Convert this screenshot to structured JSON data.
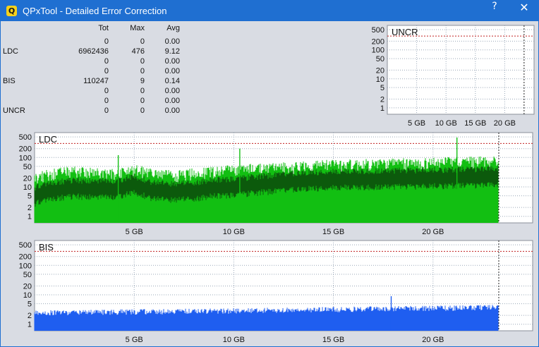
{
  "window": {
    "title": "QPxTool - Detailed Error Correction",
    "app_icon_glyph": "Q",
    "help_glyph": "?",
    "close_glyph": "✕",
    "titlebar_color": "#1f6fd1"
  },
  "stats": {
    "headers": {
      "tot": "Tot",
      "max": "Max",
      "avg": "Avg"
    },
    "rows": [
      {
        "label": "",
        "tot": "0",
        "max": "0",
        "avg": "0.00"
      },
      {
        "label": "LDC",
        "tot": "6962436",
        "max": "476",
        "avg": "9.12"
      },
      {
        "label": "",
        "tot": "0",
        "max": "0",
        "avg": "0.00"
      },
      {
        "label": "",
        "tot": "0",
        "max": "0",
        "avg": "0.00"
      },
      {
        "label": "BIS",
        "tot": "110247",
        "max": "9",
        "avg": "0.14"
      },
      {
        "label": "",
        "tot": "0",
        "max": "0",
        "avg": "0.00"
      },
      {
        "label": "",
        "tot": "0",
        "max": "0",
        "avg": "0.00"
      },
      {
        "label": "UNCR",
        "tot": "0",
        "max": "0",
        "avg": "0.00"
      }
    ]
  },
  "chart_data": [
    {
      "id": "uncr",
      "type": "area",
      "title": "UNCR",
      "yscale": "log",
      "yticks": [
        "500",
        "200",
        "100",
        "50",
        "20",
        "10",
        "5",
        "2",
        "1"
      ],
      "xticks": [
        "5 GB",
        "10 GB",
        "15 GB",
        "20 GB"
      ],
      "xlim": [
        0,
        25
      ],
      "end_gb": 23.3,
      "threshold": 300,
      "series": [
        {
          "values": [
            0
          ]
        }
      ],
      "colors": {
        "grid": "#9aa8b8",
        "threshold": "#c02020"
      }
    },
    {
      "id": "ldc",
      "type": "area",
      "title": "LDC",
      "yscale": "log",
      "yticks": [
        "500",
        "200",
        "100",
        "50",
        "20",
        "10",
        "5",
        "2",
        "1"
      ],
      "xticks": [
        "5 GB",
        "10 GB",
        "15 GB",
        "20 GB"
      ],
      "xlim": [
        0,
        25
      ],
      "end_gb": 23.3,
      "threshold": 300,
      "x": [
        0,
        1,
        2,
        3,
        4,
        5,
        6,
        7,
        8,
        9,
        10,
        11,
        12,
        13,
        14,
        15,
        16,
        17,
        18,
        19,
        20,
        21,
        22,
        23.3
      ],
      "series": [
        {
          "values": [
            20,
            30,
            35,
            30,
            28,
            40,
            28,
            25,
            30,
            35,
            40,
            45,
            45,
            50,
            55,
            60,
            60,
            62,
            65,
            65,
            70,
            72,
            75,
            80
          ]
        },
        {
          "values": [
            6,
            9,
            11,
            10,
            10,
            14,
            9,
            8,
            9,
            11,
            12,
            14,
            16,
            18,
            20,
            21,
            22,
            22,
            23,
            23,
            24,
            25,
            25,
            26
          ]
        }
      ],
      "max_value": 476,
      "colors": {
        "upper": "#12bf12",
        "lower": "#0c5a0c",
        "grid": "#9aa8b8",
        "threshold": "#c02020"
      }
    },
    {
      "id": "bis",
      "type": "area",
      "title": "BIS",
      "yscale": "log",
      "yticks": [
        "500",
        "200",
        "100",
        "50",
        "20",
        "10",
        "5",
        "2",
        "1"
      ],
      "xticks": [
        "5 GB",
        "10 GB",
        "15 GB",
        "20 GB"
      ],
      "xlim": [
        0,
        25
      ],
      "end_gb": 23.3,
      "threshold": 300,
      "x": [
        0,
        5,
        10,
        15,
        20,
        23.3
      ],
      "series": [
        {
          "values": [
            2.3,
            2.5,
            2.7,
            3.0,
            3.3,
            3.5
          ]
        }
      ],
      "max_value": 9,
      "colors": {
        "fill": "#1f5ef0",
        "grid": "#9aa8b8",
        "threshold": "#c02020"
      }
    }
  ]
}
